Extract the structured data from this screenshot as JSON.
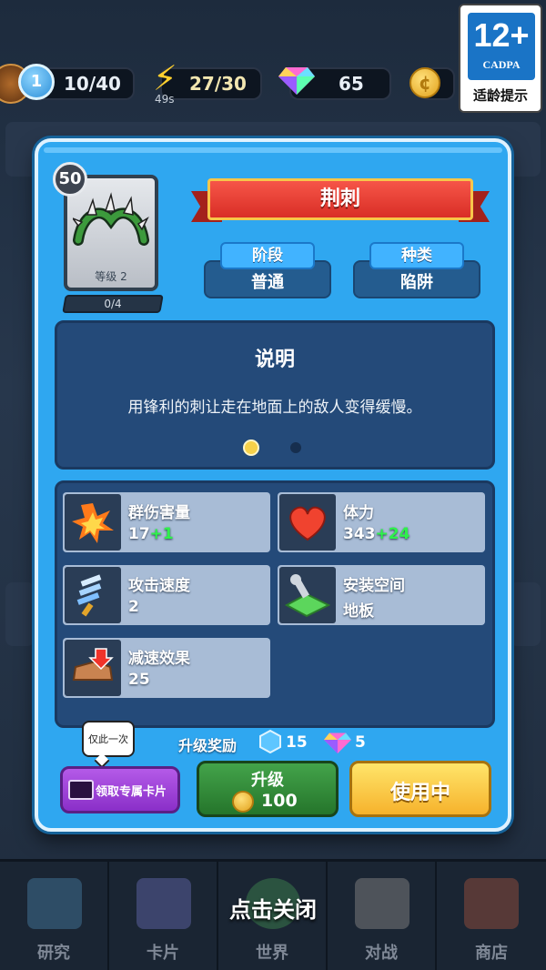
{
  "status_bar": {
    "level": "1",
    "xp": "10/40",
    "energy": "27/30",
    "energy_timer": "49s",
    "gems": "65"
  },
  "age_rating": {
    "age": "12+",
    "org": "CADPA",
    "label": "适龄提示"
  },
  "card": {
    "title": "荆刺",
    "badge": "50",
    "level_label": "等级 2",
    "progress": "0/4",
    "stage_label": "阶段",
    "stage_value": "普通",
    "type_label": "种类",
    "type_value": "陷阱"
  },
  "description": {
    "title": "说明",
    "text": "用锋利的刺让走在地面上的敌人变得缓慢。"
  },
  "stats": [
    {
      "name": "群伤害量",
      "value": "17",
      "bonus": "+1",
      "icon": "explosion-icon"
    },
    {
      "name": "体力",
      "value": "343",
      "bonus": "+24",
      "icon": "heart-icon"
    },
    {
      "name": "攻击速度",
      "value": "2",
      "bonus": "",
      "icon": "sword-icon"
    },
    {
      "name": "安装空间",
      "value": "地板",
      "bonus": "",
      "icon": "floor-icon"
    },
    {
      "name": "减速效果",
      "value": "25",
      "bonus": "",
      "icon": "slow-boot-icon"
    }
  ],
  "upgrade_reward": {
    "label": "升级奖励",
    "blue_gem": "15",
    "rainbow_gem": "5"
  },
  "buttons": {
    "tooltip": "仅此一次",
    "exclusive_card": "领取专属卡片",
    "upgrade": "升级",
    "upgrade_cost": "100",
    "use": "使用中"
  },
  "close_hint": "点击关闭",
  "nav": [
    "研究",
    "卡片",
    "世界",
    "对战",
    "商店"
  ]
}
